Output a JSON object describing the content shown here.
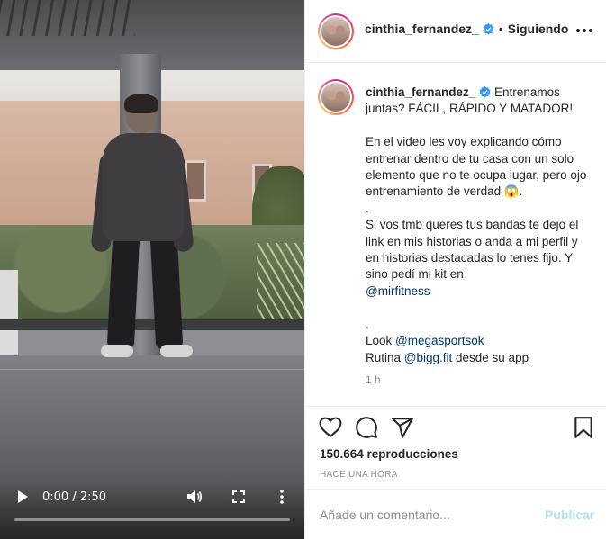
{
  "video": {
    "time_display": "0:00 / 2:50",
    "progress": 0.0
  },
  "header": {
    "username": "cinthia_fernandez_",
    "separator": "•",
    "follow_status": "Siguiendo"
  },
  "caption": {
    "username": "cinthia_fernandez_",
    "text_1": " Entrenamos juntas? FÁCIL, RÁPIDO Y MATADOR!\n\nEn el video les voy explicando cómo entrenar dentro de tu casa con un solo elemento que no te ocupa lugar, pero ojo entrenamiento de verdad 😱.\n.\nSi vos tmb queres tus bandas te dejo el link en mis historias o anda a mi perfil y en historias destacadas lo tenes fijo. Y sino pedí mi kit en\n",
    "mention_1": "@mirfitness",
    "text_2": "\n\n.\nLook ",
    "mention_2": "@megasportsok",
    "text_3": "\nRutina ",
    "mention_3": "@bigg.fit",
    "text_4": " desde su app",
    "age": "1 h"
  },
  "stats": {
    "views": "150.664 reproducciones",
    "posted": "HACE UNA HORA"
  },
  "comment": {
    "placeholder": "Añade un comentario...",
    "publish_label": "Publicar"
  },
  "colors": {
    "verified": "#3897f0",
    "link": "#00376b",
    "publish_disabled": "#b2dffc",
    "muted": "#8e8e8e"
  }
}
